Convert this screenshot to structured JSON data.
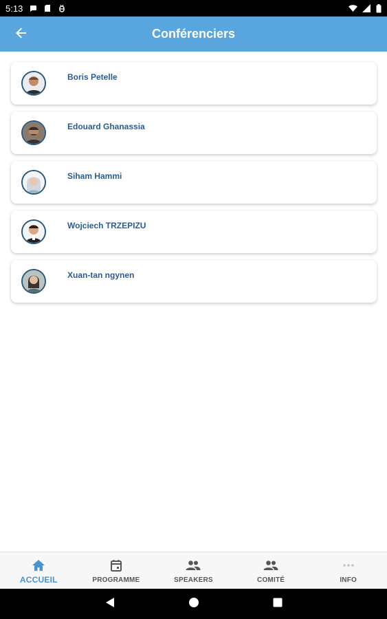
{
  "status_bar": {
    "time": "5:13",
    "left_icons": [
      "chat-icon",
      "sd-card-icon",
      "bug-icon"
    ],
    "right_icons": [
      "wifi-icon",
      "signal-icon",
      "battery-icon"
    ]
  },
  "header": {
    "title": "Conférenciers",
    "back_icon": "arrow-back-icon",
    "background": "#58a6dd"
  },
  "speakers": [
    {
      "name": "Boris Petelle"
    },
    {
      "name": "Edouard Ghanassia"
    },
    {
      "name": "Siham Hammi"
    },
    {
      "name": "Wojciech TRZEPIZU"
    },
    {
      "name": "Xuan-tan ngynen"
    }
  ],
  "bottom_nav": {
    "items": [
      {
        "label": "ACCUEIL",
        "icon": "home-icon",
        "active": true
      },
      {
        "label": "PROGRAMME",
        "icon": "calendar-icon",
        "active": false
      },
      {
        "label": "SPEAKERS",
        "icon": "people-icon",
        "active": false
      },
      {
        "label": "COMITÉ",
        "icon": "people-icon",
        "active": false
      },
      {
        "label": "INFO",
        "icon": "more-icon",
        "active": false
      }
    ],
    "active_color": "#4a93d0"
  },
  "system_nav": [
    "back-triangle-icon",
    "home-circle-icon",
    "recents-square-icon"
  ]
}
